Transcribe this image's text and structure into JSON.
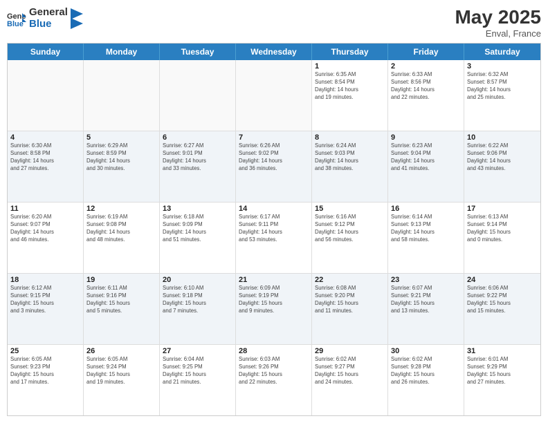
{
  "header": {
    "logo_general": "General",
    "logo_blue": "Blue",
    "month_title": "May 2025",
    "location": "Enval, France"
  },
  "days_of_week": [
    "Sunday",
    "Monday",
    "Tuesday",
    "Wednesday",
    "Thursday",
    "Friday",
    "Saturday"
  ],
  "weeks": [
    [
      {
        "day": "",
        "info": "",
        "empty": true
      },
      {
        "day": "",
        "info": "",
        "empty": true
      },
      {
        "day": "",
        "info": "",
        "empty": true
      },
      {
        "day": "",
        "info": "",
        "empty": true
      },
      {
        "day": "1",
        "info": "Sunrise: 6:35 AM\nSunset: 8:54 PM\nDaylight: 14 hours\nand 19 minutes."
      },
      {
        "day": "2",
        "info": "Sunrise: 6:33 AM\nSunset: 8:56 PM\nDaylight: 14 hours\nand 22 minutes."
      },
      {
        "day": "3",
        "info": "Sunrise: 6:32 AM\nSunset: 8:57 PM\nDaylight: 14 hours\nand 25 minutes."
      }
    ],
    [
      {
        "day": "4",
        "info": "Sunrise: 6:30 AM\nSunset: 8:58 PM\nDaylight: 14 hours\nand 27 minutes."
      },
      {
        "day": "5",
        "info": "Sunrise: 6:29 AM\nSunset: 8:59 PM\nDaylight: 14 hours\nand 30 minutes."
      },
      {
        "day": "6",
        "info": "Sunrise: 6:27 AM\nSunset: 9:01 PM\nDaylight: 14 hours\nand 33 minutes."
      },
      {
        "day": "7",
        "info": "Sunrise: 6:26 AM\nSunset: 9:02 PM\nDaylight: 14 hours\nand 36 minutes."
      },
      {
        "day": "8",
        "info": "Sunrise: 6:24 AM\nSunset: 9:03 PM\nDaylight: 14 hours\nand 38 minutes."
      },
      {
        "day": "9",
        "info": "Sunrise: 6:23 AM\nSunset: 9:04 PM\nDaylight: 14 hours\nand 41 minutes."
      },
      {
        "day": "10",
        "info": "Sunrise: 6:22 AM\nSunset: 9:06 PM\nDaylight: 14 hours\nand 43 minutes."
      }
    ],
    [
      {
        "day": "11",
        "info": "Sunrise: 6:20 AM\nSunset: 9:07 PM\nDaylight: 14 hours\nand 46 minutes."
      },
      {
        "day": "12",
        "info": "Sunrise: 6:19 AM\nSunset: 9:08 PM\nDaylight: 14 hours\nand 48 minutes."
      },
      {
        "day": "13",
        "info": "Sunrise: 6:18 AM\nSunset: 9:09 PM\nDaylight: 14 hours\nand 51 minutes."
      },
      {
        "day": "14",
        "info": "Sunrise: 6:17 AM\nSunset: 9:11 PM\nDaylight: 14 hours\nand 53 minutes."
      },
      {
        "day": "15",
        "info": "Sunrise: 6:16 AM\nSunset: 9:12 PM\nDaylight: 14 hours\nand 56 minutes."
      },
      {
        "day": "16",
        "info": "Sunrise: 6:14 AM\nSunset: 9:13 PM\nDaylight: 14 hours\nand 58 minutes."
      },
      {
        "day": "17",
        "info": "Sunrise: 6:13 AM\nSunset: 9:14 PM\nDaylight: 15 hours\nand 0 minutes."
      }
    ],
    [
      {
        "day": "18",
        "info": "Sunrise: 6:12 AM\nSunset: 9:15 PM\nDaylight: 15 hours\nand 3 minutes."
      },
      {
        "day": "19",
        "info": "Sunrise: 6:11 AM\nSunset: 9:16 PM\nDaylight: 15 hours\nand 5 minutes."
      },
      {
        "day": "20",
        "info": "Sunrise: 6:10 AM\nSunset: 9:18 PM\nDaylight: 15 hours\nand 7 minutes."
      },
      {
        "day": "21",
        "info": "Sunrise: 6:09 AM\nSunset: 9:19 PM\nDaylight: 15 hours\nand 9 minutes."
      },
      {
        "day": "22",
        "info": "Sunrise: 6:08 AM\nSunset: 9:20 PM\nDaylight: 15 hours\nand 11 minutes."
      },
      {
        "day": "23",
        "info": "Sunrise: 6:07 AM\nSunset: 9:21 PM\nDaylight: 15 hours\nand 13 minutes."
      },
      {
        "day": "24",
        "info": "Sunrise: 6:06 AM\nSunset: 9:22 PM\nDaylight: 15 hours\nand 15 minutes."
      }
    ],
    [
      {
        "day": "25",
        "info": "Sunrise: 6:05 AM\nSunset: 9:23 PM\nDaylight: 15 hours\nand 17 minutes."
      },
      {
        "day": "26",
        "info": "Sunrise: 6:05 AM\nSunset: 9:24 PM\nDaylight: 15 hours\nand 19 minutes."
      },
      {
        "day": "27",
        "info": "Sunrise: 6:04 AM\nSunset: 9:25 PM\nDaylight: 15 hours\nand 21 minutes."
      },
      {
        "day": "28",
        "info": "Sunrise: 6:03 AM\nSunset: 9:26 PM\nDaylight: 15 hours\nand 22 minutes."
      },
      {
        "day": "29",
        "info": "Sunrise: 6:02 AM\nSunset: 9:27 PM\nDaylight: 15 hours\nand 24 minutes."
      },
      {
        "day": "30",
        "info": "Sunrise: 6:02 AM\nSunset: 9:28 PM\nDaylight: 15 hours\nand 26 minutes."
      },
      {
        "day": "31",
        "info": "Sunrise: 6:01 AM\nSunset: 9:29 PM\nDaylight: 15 hours\nand 27 minutes."
      }
    ]
  ]
}
